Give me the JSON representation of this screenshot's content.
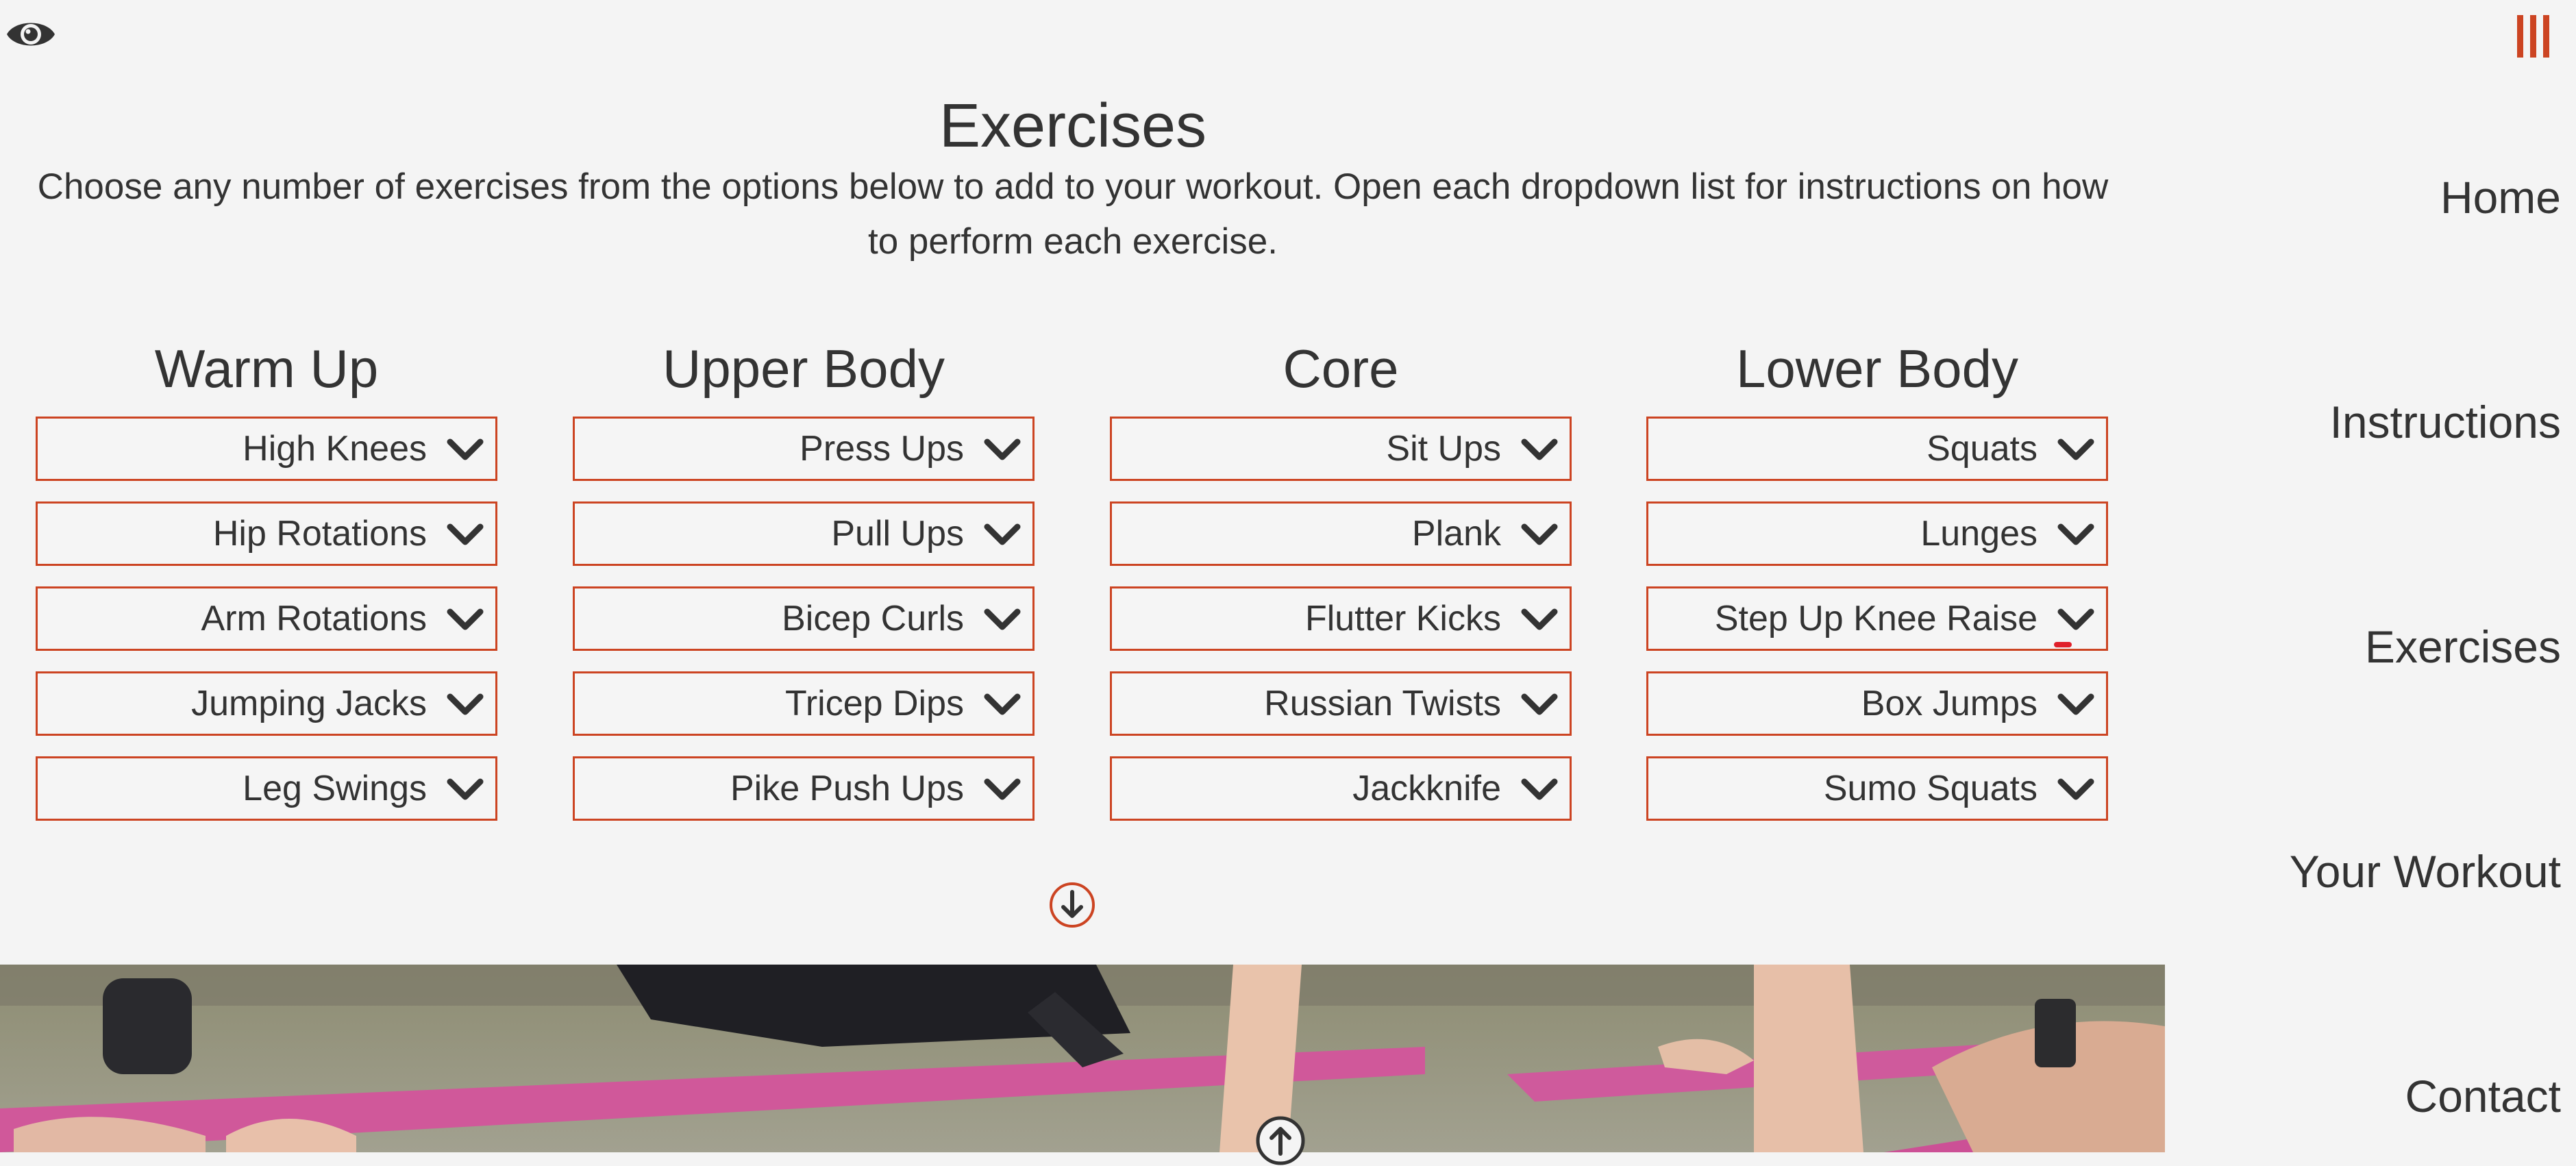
{
  "page": {
    "title": "Exercises",
    "intro": "Choose any number of exercises from the options below to add to your workout. Open each dropdown list for instructions on how to perform each exercise."
  },
  "categories": [
    {
      "heading": "Warm Up",
      "items": [
        "High Knees",
        "Hip Rotations",
        "Arm Rotations",
        "Jumping Jacks",
        "Leg Swings"
      ]
    },
    {
      "heading": "Upper Body",
      "items": [
        "Press Ups",
        "Pull Ups",
        "Bicep Curls",
        "Tricep Dips",
        "Pike Push Ups"
      ]
    },
    {
      "heading": "Core",
      "items": [
        "Sit Ups",
        "Plank",
        "Flutter Kicks",
        "Russian Twists",
        "Jackknife"
      ]
    },
    {
      "heading": "Lower Body",
      "items": [
        "Squats",
        "Lunges",
        "Step Up Knee Raise",
        "Box Jumps",
        "Sumo Squats"
      ]
    }
  ],
  "nav": {
    "items": [
      "Home",
      "Instructions",
      "Exercises",
      "Your Workout",
      "Contact"
    ]
  },
  "icons": {
    "accessibility": "eye-icon",
    "menu": "menu-bars-icon",
    "dropdown": "chevron-down-icon",
    "scroll_down": "arrow-down-circle-icon",
    "scroll_up": "arrow-up-circle-icon"
  },
  "colors": {
    "accent": "#cc4422",
    "text": "#333333",
    "background": "#f4f4f4"
  }
}
